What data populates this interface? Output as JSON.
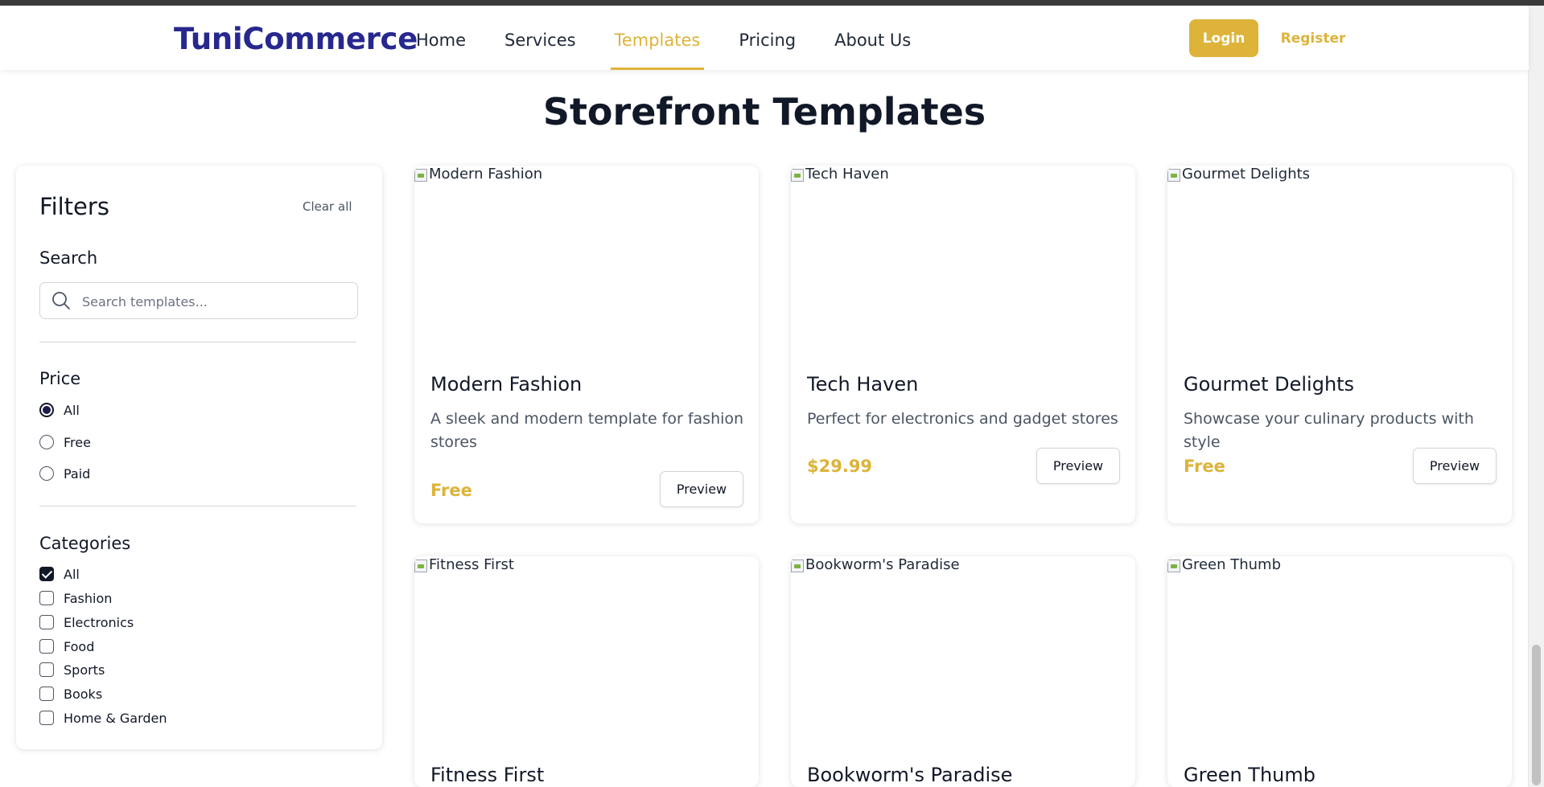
{
  "header": {
    "logo": "TuniCommerce",
    "nav": [
      "Home",
      "Services",
      "Templates",
      "Pricing",
      "About Us"
    ],
    "active_nav": "Templates",
    "login": "Login",
    "register": "Register"
  },
  "page_title": "Storefront Templates",
  "filters": {
    "title": "Filters",
    "clear_all": "Clear all",
    "search": {
      "label": "Search",
      "placeholder": "Search templates..."
    },
    "price": {
      "label": "Price",
      "options": [
        "All",
        "Free",
        "Paid"
      ],
      "selected": "All"
    },
    "categories": {
      "label": "Categories",
      "options": [
        "All",
        "Fashion",
        "Electronics",
        "Food",
        "Sports",
        "Books",
        "Home & Garden"
      ],
      "checked": [
        "All"
      ]
    }
  },
  "templates": [
    {
      "name": "Modern Fashion",
      "alt": "Modern Fashion",
      "description": "A sleek and modern template for fashion stores",
      "price": "Free",
      "preview": "Preview"
    },
    {
      "name": "Tech Haven",
      "alt": "Tech Haven",
      "description": "Perfect for electronics and gadget stores",
      "price": "$29.99",
      "preview": "Preview"
    },
    {
      "name": "Gourmet Delights",
      "alt": "Gourmet Delights",
      "description": "Showcase your culinary products with style",
      "price": "Free",
      "preview": "Preview"
    },
    {
      "name": "Fitness First",
      "alt": "Fitness First"
    },
    {
      "name": "Bookworm's Paradise",
      "alt": "Bookworm's Paradise"
    },
    {
      "name": "Green Thumb",
      "alt": "Green Thumb"
    }
  ],
  "colors": {
    "brand": "#27288e",
    "accent": "#ddb339",
    "text": "#111827"
  }
}
